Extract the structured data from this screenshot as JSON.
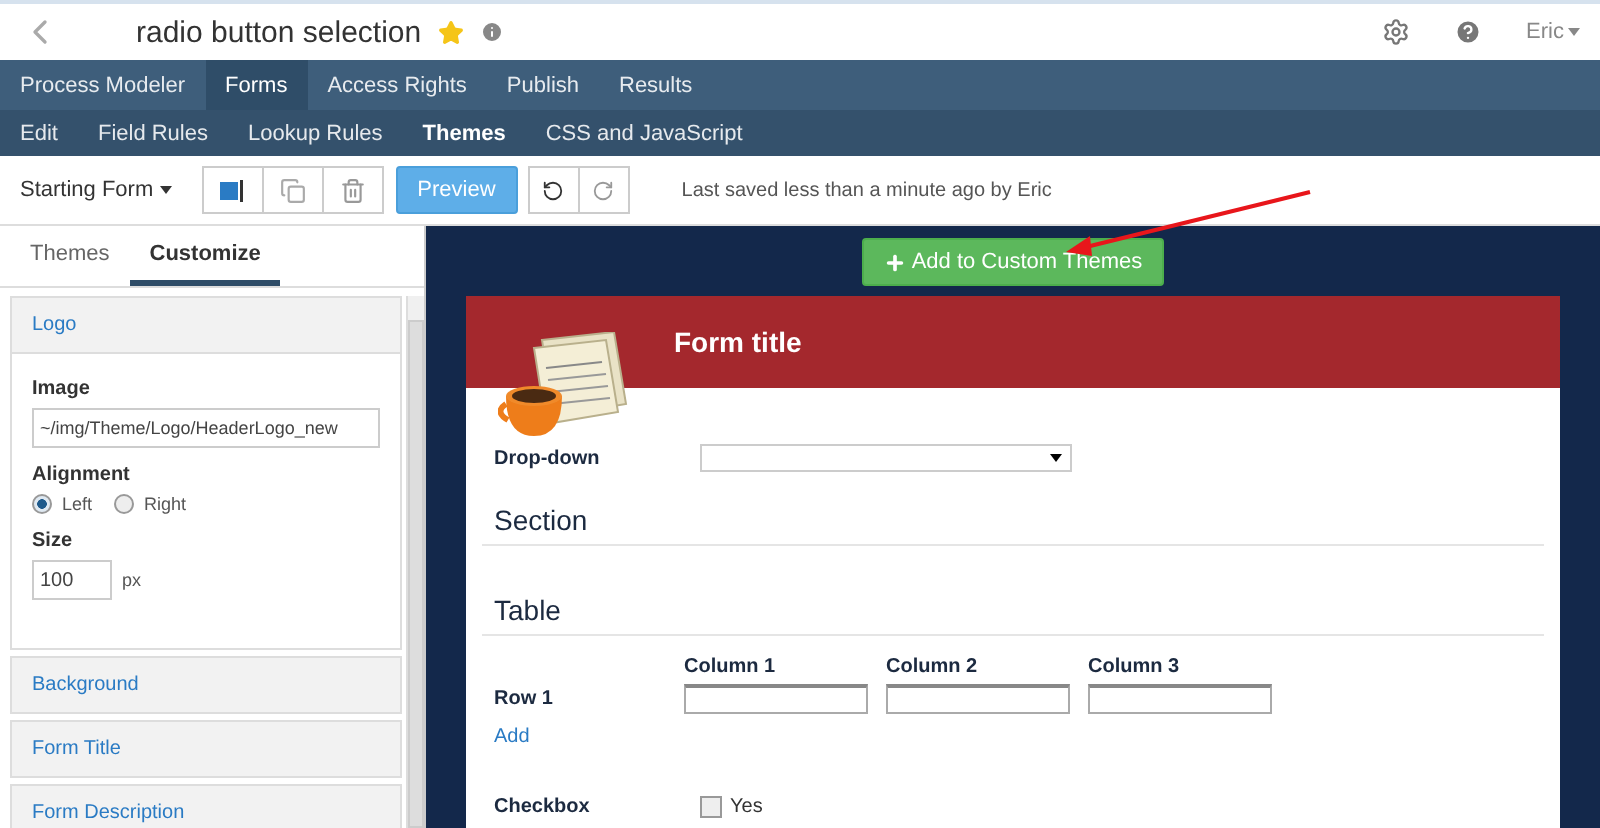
{
  "header": {
    "title": "radio button selection",
    "favorite": true,
    "user": "Eric"
  },
  "main_nav": [
    {
      "label": "Process Modeler",
      "selected": false
    },
    {
      "label": "Forms",
      "selected": true
    },
    {
      "label": "Access Rights",
      "selected": false
    },
    {
      "label": "Publish",
      "selected": false
    },
    {
      "label": "Results",
      "selected": false
    }
  ],
  "sub_nav": [
    {
      "label": "Edit",
      "selected": false
    },
    {
      "label": "Field Rules",
      "selected": false
    },
    {
      "label": "Lookup Rules",
      "selected": false
    },
    {
      "label": "Themes",
      "selected": true
    },
    {
      "label": "CSS and JavaScript",
      "selected": false
    }
  ],
  "toolbar": {
    "form_menu": "Starting Form",
    "preview": "Preview",
    "status": "Last saved less than a minute ago by Eric"
  },
  "panel_tabs": [
    {
      "label": "Themes",
      "selected": false
    },
    {
      "label": "Customize",
      "selected": true
    }
  ],
  "sections": [
    {
      "label": "Logo",
      "settings": {
        "image_label": "Image",
        "image_value": "~/img/Theme/Logo/HeaderLogo_new",
        "alignment_label": "Alignment",
        "alignment_options": [
          {
            "label": "Left",
            "selected": true
          },
          {
            "label": "Right",
            "selected": false
          }
        ],
        "size_label": "Size",
        "size_value": "100",
        "size_unit": "px"
      }
    },
    {
      "label": "Background"
    },
    {
      "label": "Form Title"
    },
    {
      "label": "Form Description"
    }
  ],
  "add_button": "Add to Custom Themes",
  "form": {
    "title": "Form title",
    "dropdown_label": "Drop-down",
    "section": "Section",
    "table": "Table",
    "columns": [
      "Column 1",
      "Column 2",
      "Column 3"
    ],
    "row_label": "Row 1",
    "add_link": "Add",
    "checkbox_label": "Checkbox",
    "checkbox_option": {
      "label": "Yes",
      "checked": false
    }
  }
}
